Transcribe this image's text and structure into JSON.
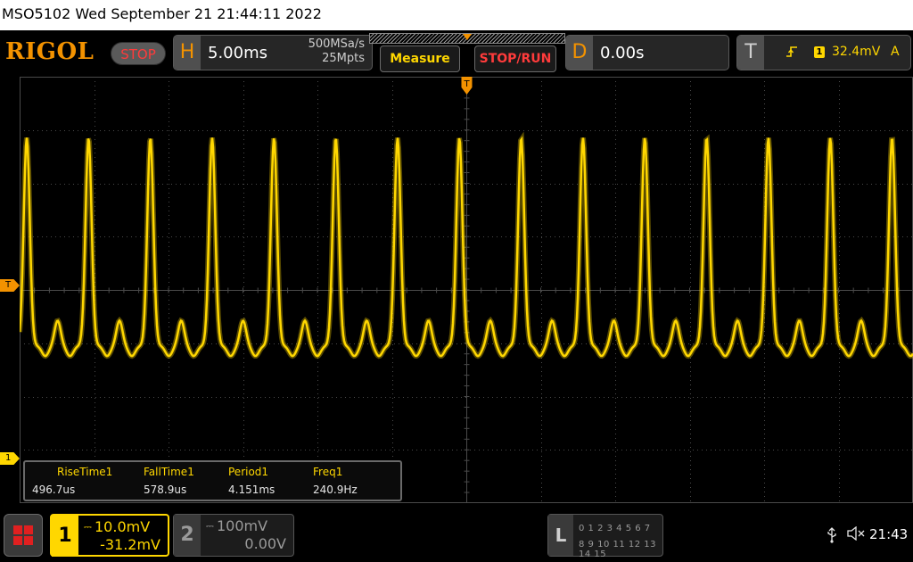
{
  "status_line": "MSO5102  Wed September 21 21:44:11 2022",
  "brand": "RIGOL",
  "run_state": "STOP",
  "horizontal": {
    "key": "H",
    "timebase": "5.00ms",
    "sample_rate": "500MSa/s",
    "memory_depth": "25Mpts"
  },
  "buttons": {
    "measure": "Measure",
    "stop_run": "STOP/RUN"
  },
  "delay": {
    "key": "D",
    "value": "0.00s"
  },
  "trigger": {
    "key": "T",
    "source_badge": "1",
    "level": "32.4mV",
    "mode": "A"
  },
  "markers": {
    "trigger_level": "T",
    "ch1_ground": "1"
  },
  "measurements": [
    {
      "name": "RiseTime1",
      "value": "496.7us"
    },
    {
      "name": "FallTime1",
      "value": "578.9us"
    },
    {
      "name": "Period1",
      "value": "4.151ms"
    },
    {
      "name": "Freq1",
      "value": "240.9Hz"
    }
  ],
  "channels": [
    {
      "number": "1",
      "scale": "10.0mV",
      "offset": "-31.2mV",
      "color": "#ffd700"
    },
    {
      "number": "2",
      "scale": "100mV",
      "offset": "0.00V",
      "color": "#9a9a9a"
    }
  ],
  "logic": {
    "key": "L",
    "row1": "0 1 2 3  4 5 6 7",
    "row2": "8 9 10 11 12 13 14 15"
  },
  "clock": "21:43",
  "colors": {
    "brand": "#f39200",
    "trace": "#ffd700",
    "stop": "#ff3b3b",
    "grid": "#4a4a4a"
  },
  "waveform": {
    "period_ms": 4.151,
    "timebase_ms_per_div": 5.0,
    "volts_per_div_mV": 10.0,
    "peak_offset_mV": 13,
    "baseline_offset_mV": -6
  }
}
